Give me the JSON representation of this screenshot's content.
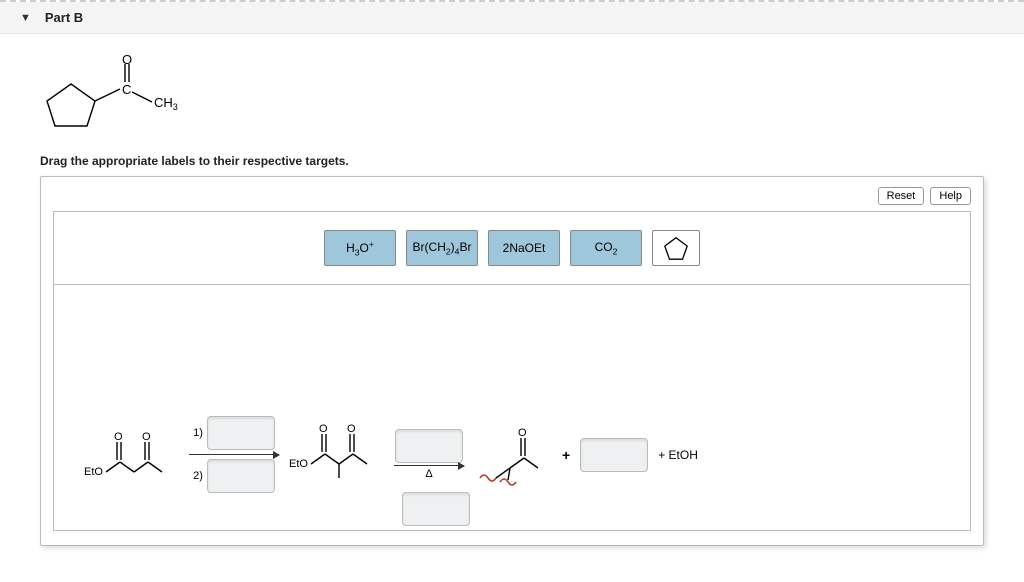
{
  "header": {
    "part_label": "Part B"
  },
  "prompt": {
    "molecule_name": "1-(cyclopentyl)ethan-1-one",
    "methyl_label": "CH",
    "methyl_sub": "3",
    "o_label": "O",
    "c_label": "C"
  },
  "instruction": "Drag the appropriate labels to their respective targets.",
  "toolbar": {
    "reset_label": "Reset",
    "help_label": "Help"
  },
  "labels": [
    {
      "id": "h3o",
      "html_main": "H",
      "sub": "3",
      "suffix": "O",
      "sup": "+"
    },
    {
      "id": "brch2",
      "html_main": "Br(CH",
      "sub": "2",
      "suffix": ")",
      "sub2": "4",
      "tail": "Br"
    },
    {
      "id": "naOEt",
      "html_main": "2NaOEt"
    },
    {
      "id": "co2",
      "html_main": "CO",
      "sub": "2"
    },
    {
      "id": "cyclopentane",
      "shape": "pentagon"
    }
  ],
  "scheme": {
    "eto": "EtO",
    "step1": "1)",
    "step2": "2)",
    "delta": "Δ",
    "plus": "+",
    "etoh_prefix": "+ ",
    "etoh": "EtOH",
    "o_label": "O"
  }
}
